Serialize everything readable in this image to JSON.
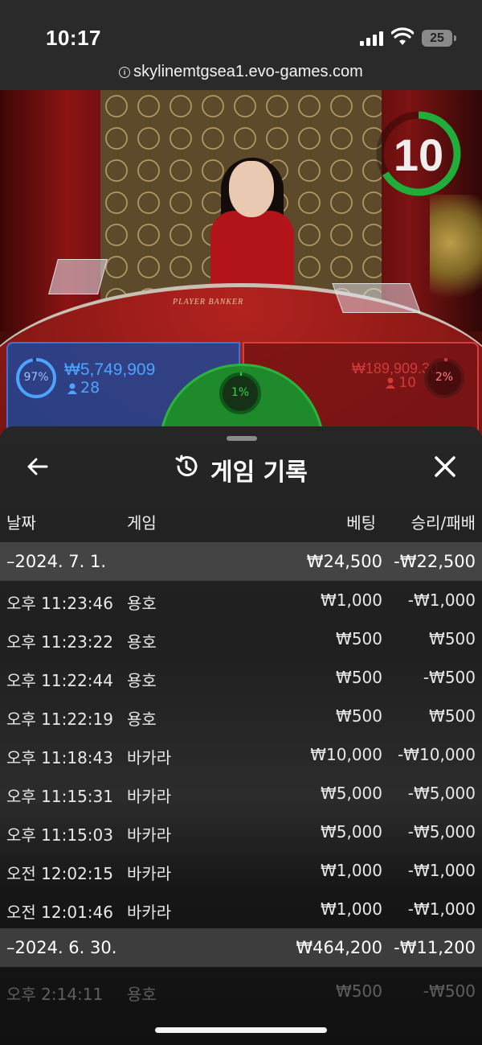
{
  "status_bar": {
    "time": "10:17",
    "battery": "25",
    "url": "skylinemtgsea1.evo-games.com"
  },
  "game": {
    "timer": "10",
    "table_text": "PLAYER  BANKER",
    "player": {
      "percent": "97%",
      "amount": "₩5,749,909",
      "count": "28",
      "color": "#4ea3ff"
    },
    "banker": {
      "percent": "2%",
      "amount": "₩189,909.30",
      "count": "10",
      "color": "#d13a3a"
    },
    "tie": {
      "percent": "1%",
      "color": "#2fd645"
    }
  },
  "panel": {
    "title": "게임 기록",
    "columns": {
      "date": "날짜",
      "game": "게임",
      "bet": "베팅",
      "result": "승리/패배"
    },
    "sections": [
      {
        "date": "–2024. 7. 1.",
        "bet": "₩24,500",
        "result": "-₩22,500",
        "rows": [
          {
            "time": "오후 11:23:46",
            "game": "용호",
            "bet": "₩1,000",
            "result": "-₩1,000"
          },
          {
            "time": "오후 11:23:22",
            "game": "용호",
            "bet": "₩500",
            "result": "₩500"
          },
          {
            "time": "오후 11:22:44",
            "game": "용호",
            "bet": "₩500",
            "result": "-₩500"
          },
          {
            "time": "오후 11:22:19",
            "game": "용호",
            "bet": "₩500",
            "result": "₩500"
          },
          {
            "time": "오후 11:18:43",
            "game": "바카라",
            "bet": "₩10,000",
            "result": "-₩10,000"
          },
          {
            "time": "오후 11:15:31",
            "game": "바카라",
            "bet": "₩5,000",
            "result": "-₩5,000"
          },
          {
            "time": "오후 11:15:03",
            "game": "바카라",
            "bet": "₩5,000",
            "result": "-₩5,000"
          },
          {
            "time": "오전 12:02:15",
            "game": "바카라",
            "bet": "₩1,000",
            "result": "-₩1,000"
          },
          {
            "time": "오전 12:01:46",
            "game": "바카라",
            "bet": "₩1,000",
            "result": "-₩1,000"
          }
        ]
      },
      {
        "date": "–2024. 6. 30.",
        "bet": "₩464,200",
        "result": "-₩11,200",
        "rows": [
          {
            "time": "오후 2:14:11",
            "game": "용호",
            "bet": "₩500",
            "result": "-₩500"
          }
        ]
      }
    ]
  }
}
